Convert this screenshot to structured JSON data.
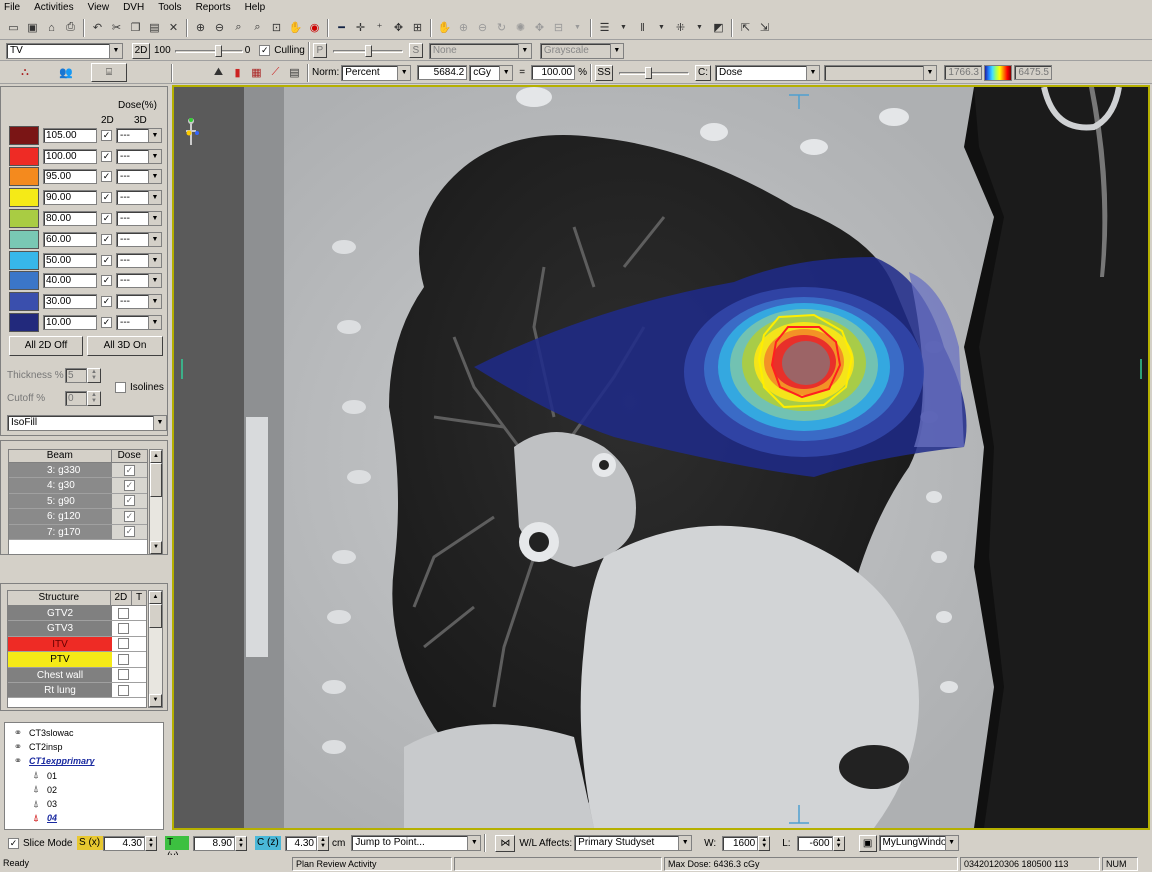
{
  "menu": [
    "File",
    "Activities",
    "View",
    "DVH",
    "Tools",
    "Reports",
    "Help"
  ],
  "row2": {
    "structure_select": "TV",
    "mode_label": "2D",
    "level_value": "100",
    "level_end": "0",
    "culling_label": "Culling",
    "culling_checked": true,
    "p_label": "P",
    "s_label": "S",
    "overlay_select": "None",
    "colormap_select": "Grayscale"
  },
  "row3": {
    "norm_label": "Norm:",
    "norm_select": "Percent",
    "norm_dose": "5684.2",
    "dose_unit": "cGy",
    "equals": "=",
    "norm_percent": "100.00",
    "percent_sign": "%",
    "ss_label": "SS",
    "c_label": "C:",
    "display_select": "Dose",
    "range_min": "1766.3",
    "range_max": "6475.5"
  },
  "isodose": {
    "header": "Dose(%)",
    "col2d": "2D",
    "col3d": "3D",
    "levels": [
      {
        "value": "105.00",
        "color": "#7a1515",
        "on2d": true,
        "opt3d": "---"
      },
      {
        "value": "100.00",
        "color": "#ee2b25",
        "on2d": true,
        "opt3d": "---"
      },
      {
        "value": "95.00",
        "color": "#f48a1e",
        "on2d": true,
        "opt3d": "---"
      },
      {
        "value": "90.00",
        "color": "#f5ea17",
        "on2d": true,
        "opt3d": "---"
      },
      {
        "value": "80.00",
        "color": "#a9cc43",
        "on2d": true,
        "opt3d": "---"
      },
      {
        "value": "60.00",
        "color": "#79c8b4",
        "on2d": true,
        "opt3d": "---"
      },
      {
        "value": "50.00",
        "color": "#37b7ea",
        "on2d": true,
        "opt3d": "---"
      },
      {
        "value": "40.00",
        "color": "#3b76c8",
        "on2d": true,
        "opt3d": "---"
      },
      {
        "value": "30.00",
        "color": "#3a4fad",
        "on2d": true,
        "opt3d": "---"
      },
      {
        "value": "10.00",
        "color": "#22297c",
        "on2d": true,
        "opt3d": "---"
      }
    ],
    "all2d_label": "All 2D Off",
    "all3d_label": "All 3D On",
    "thickness_label": "Thickness %",
    "thickness_value": "5",
    "cutoff_label": "Cutoff %",
    "cutoff_value": "0",
    "isolines_label": "Isolines",
    "isolines_checked": false,
    "render_select": "IsoFill"
  },
  "beams": {
    "col_beam": "Beam",
    "col_dose": "Dose",
    "rows": [
      {
        "name": "3: g330",
        "checked": true
      },
      {
        "name": "4: g30",
        "checked": true
      },
      {
        "name": "5: g90",
        "checked": true
      },
      {
        "name": "6: g120",
        "checked": true
      },
      {
        "name": "7: g170",
        "checked": true
      }
    ]
  },
  "structures": {
    "col_structure": "Structure",
    "col_2d": "2D",
    "col_t": "T",
    "rows": [
      {
        "name": "GTV2",
        "color": "#808080",
        "checked": false
      },
      {
        "name": "GTV3",
        "color": "#808080",
        "checked": false
      },
      {
        "name": "ITV",
        "color": "#ee2b25",
        "checked": false
      },
      {
        "name": "PTV",
        "color": "#f5ea17",
        "checked": false
      },
      {
        "name": "Chest wall",
        "color": "#808080",
        "checked": false
      },
      {
        "name": "Rt lung",
        "color": "#808080",
        "checked": false
      }
    ]
  },
  "tree": {
    "items": [
      {
        "label": "CT3slowac",
        "indent": 0,
        "type": "ct"
      },
      {
        "label": "CT2insp",
        "indent": 0,
        "type": "ct"
      },
      {
        "label": "CT1expprimary",
        "indent": 0,
        "type": "ct",
        "active": true
      },
      {
        "label": "01",
        "indent": 1,
        "type": "beam"
      },
      {
        "label": "02",
        "indent": 1,
        "type": "beam"
      },
      {
        "label": "03",
        "indent": 1,
        "type": "beam"
      },
      {
        "label": "04",
        "indent": 1,
        "type": "beam",
        "active": true
      }
    ]
  },
  "bottom": {
    "slice_mode_label": "Slice Mode",
    "slice_mode_checked": true,
    "s_label": "S (x)",
    "s_value": "4.30",
    "t_label": "T (y)",
    "t_value": "8.90",
    "c_label": "C (z)",
    "c_value": "4.30",
    "unit": "cm",
    "jump_select": "Jump to Point...",
    "wl_label": "W/L Affects:",
    "wl_select": "Primary Studyset",
    "w_label": "W:",
    "w_value": "1600",
    "l_label": "L:",
    "l_value": "-600",
    "preset_select": "MyLungWindo"
  },
  "status": {
    "ready": "Ready",
    "activity": "Plan Review Activity",
    "max_dose": "Max Dose: 6436.3 cGy",
    "datetime": "03420120306 180500 113",
    "num": "NUM"
  },
  "colors": {
    "frame": "#b5b000",
    "background": "#d4d0c8"
  }
}
